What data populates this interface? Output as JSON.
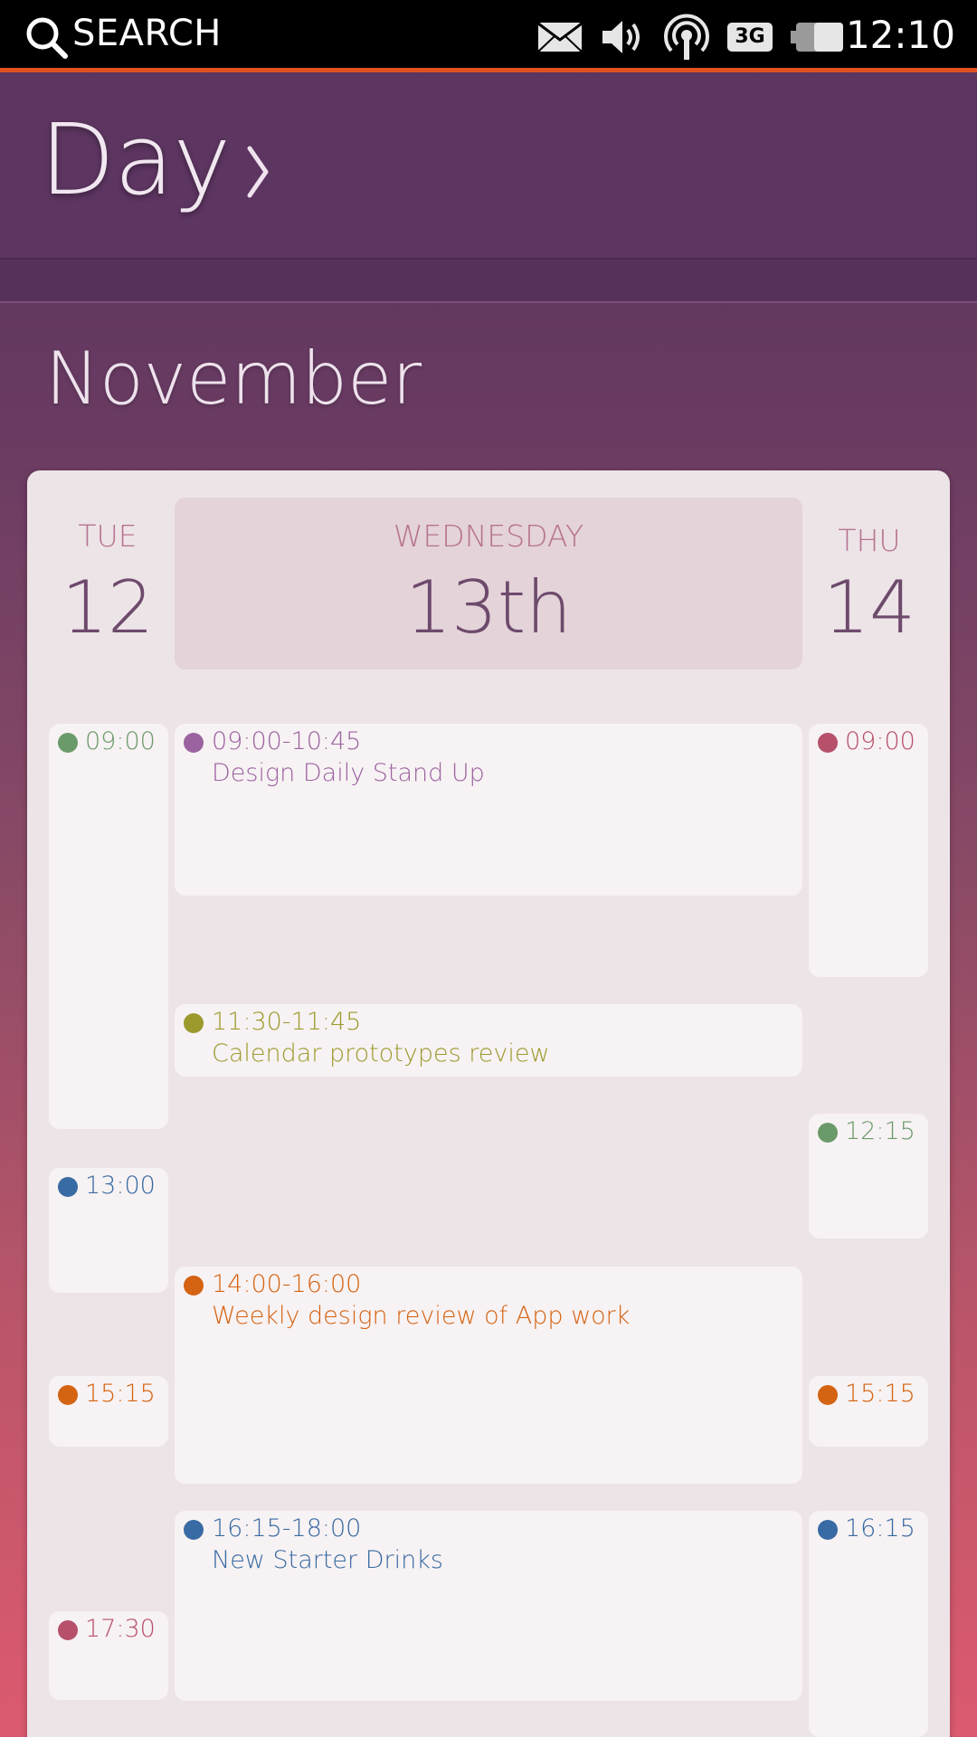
{
  "status_bar": {
    "search_label": "SEARCH",
    "network_label": "3G",
    "time": "12:10",
    "icons": [
      "search-icon",
      "envelope-icon",
      "volume-icon",
      "broadcast-icon",
      "network-3g-icon",
      "battery-icon"
    ]
  },
  "header": {
    "title": "Day",
    "chevron_icon": "chevron-right-icon"
  },
  "month": "November",
  "days": {
    "prev": {
      "label": "TUE",
      "number": "12"
    },
    "current": {
      "label": "WEDNESDAY",
      "number": "13th"
    },
    "next": {
      "label": "THU",
      "number": "14"
    }
  },
  "colors": {
    "green": "#6b9a6a",
    "purple": "#9b62a0",
    "olive": "#9c9a2d",
    "blue": "#386aa3",
    "orange": "#d46312",
    "rose": "#b6506b",
    "header_bg": "#5c3560",
    "accent": "#e0521f"
  },
  "events": {
    "tue": [
      {
        "time": "09:00",
        "color": "#6b9a6a"
      },
      {
        "time": "13:00",
        "color": "#386aa3"
      },
      {
        "time": "15:15",
        "color": "#d46312"
      },
      {
        "time": "17:30",
        "color": "#b6506b"
      }
    ],
    "wed": [
      {
        "time": "09:00-10:45",
        "title": "Design Daily Stand Up",
        "color": "#9b62a0"
      },
      {
        "time": "11:30-11:45",
        "title": "Calendar prototypes review",
        "color": "#9c9a2d"
      },
      {
        "time": "14:00-16:00",
        "title": "Weekly design review of App work",
        "color": "#d46312"
      },
      {
        "time": "16:15-18:00",
        "title": "New Starter Drinks",
        "color": "#386aa3"
      }
    ],
    "thu": [
      {
        "time": "09:00",
        "color": "#b6506b"
      },
      {
        "time": "12:15",
        "color": "#6b9a6a"
      },
      {
        "time": "15:15",
        "color": "#d46312"
      },
      {
        "time": "16:15",
        "color": "#386aa3"
      }
    ]
  }
}
